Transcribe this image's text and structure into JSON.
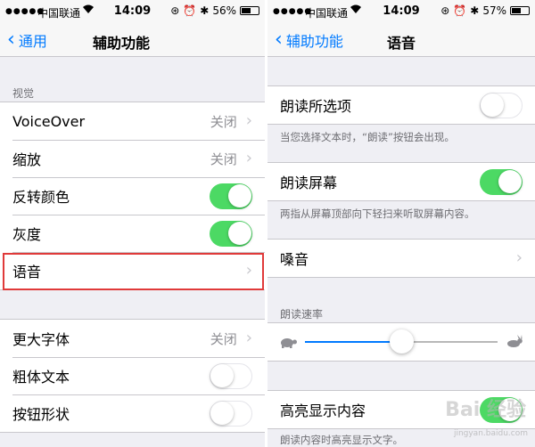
{
  "left": {
    "status": {
      "carrier": "中国联通",
      "time": "14:09",
      "battery_text": "56%",
      "battery_level": 0.56
    },
    "nav": {
      "back_label": "通用",
      "title": "辅助功能"
    },
    "section_vision": "视觉",
    "rows_vision": [
      {
        "label": "VoiceOver",
        "value": "关闭",
        "type": "disclosure"
      },
      {
        "label": "缩放",
        "value": "关闭",
        "type": "disclosure"
      },
      {
        "label": "反转颜色",
        "type": "switch",
        "on": true
      },
      {
        "label": "灰度",
        "type": "switch",
        "on": true
      },
      {
        "label": "语音",
        "type": "disclosure"
      }
    ],
    "rows_text": [
      {
        "label": "更大字体",
        "value": "关闭",
        "type": "disclosure"
      },
      {
        "label": "粗体文本",
        "type": "switch",
        "on": false
      },
      {
        "label": "按钮形状",
        "type": "switch",
        "on": false
      }
    ]
  },
  "right": {
    "status": {
      "carrier": "中国联通",
      "time": "14:09",
      "battery_text": "57%",
      "battery_level": 0.57
    },
    "nav": {
      "back_label": "辅助功能",
      "title": "语音"
    },
    "speak_selection": {
      "label": "朗读所选项",
      "on": false,
      "note": "当您选择文本时，“朗读”按钮会出现。"
    },
    "speak_screen": {
      "label": "朗读屏幕",
      "on": true,
      "note": "两指从屏幕顶部向下轻扫来听取屏幕内容。"
    },
    "voices": {
      "label": "嗓音"
    },
    "rate": {
      "header": "朗读速率",
      "value": 0.5
    },
    "highlight": {
      "label": "高亮显示内容",
      "on": true,
      "note": "朗读内容时高亮显示文字。"
    }
  },
  "watermark": {
    "main": "Bai 经验",
    "sub": "jingyan.baidu.com"
  },
  "colors": {
    "accent": "#007aff",
    "switch_on": "#4cd964",
    "highlight_box": "#e03a3a"
  }
}
